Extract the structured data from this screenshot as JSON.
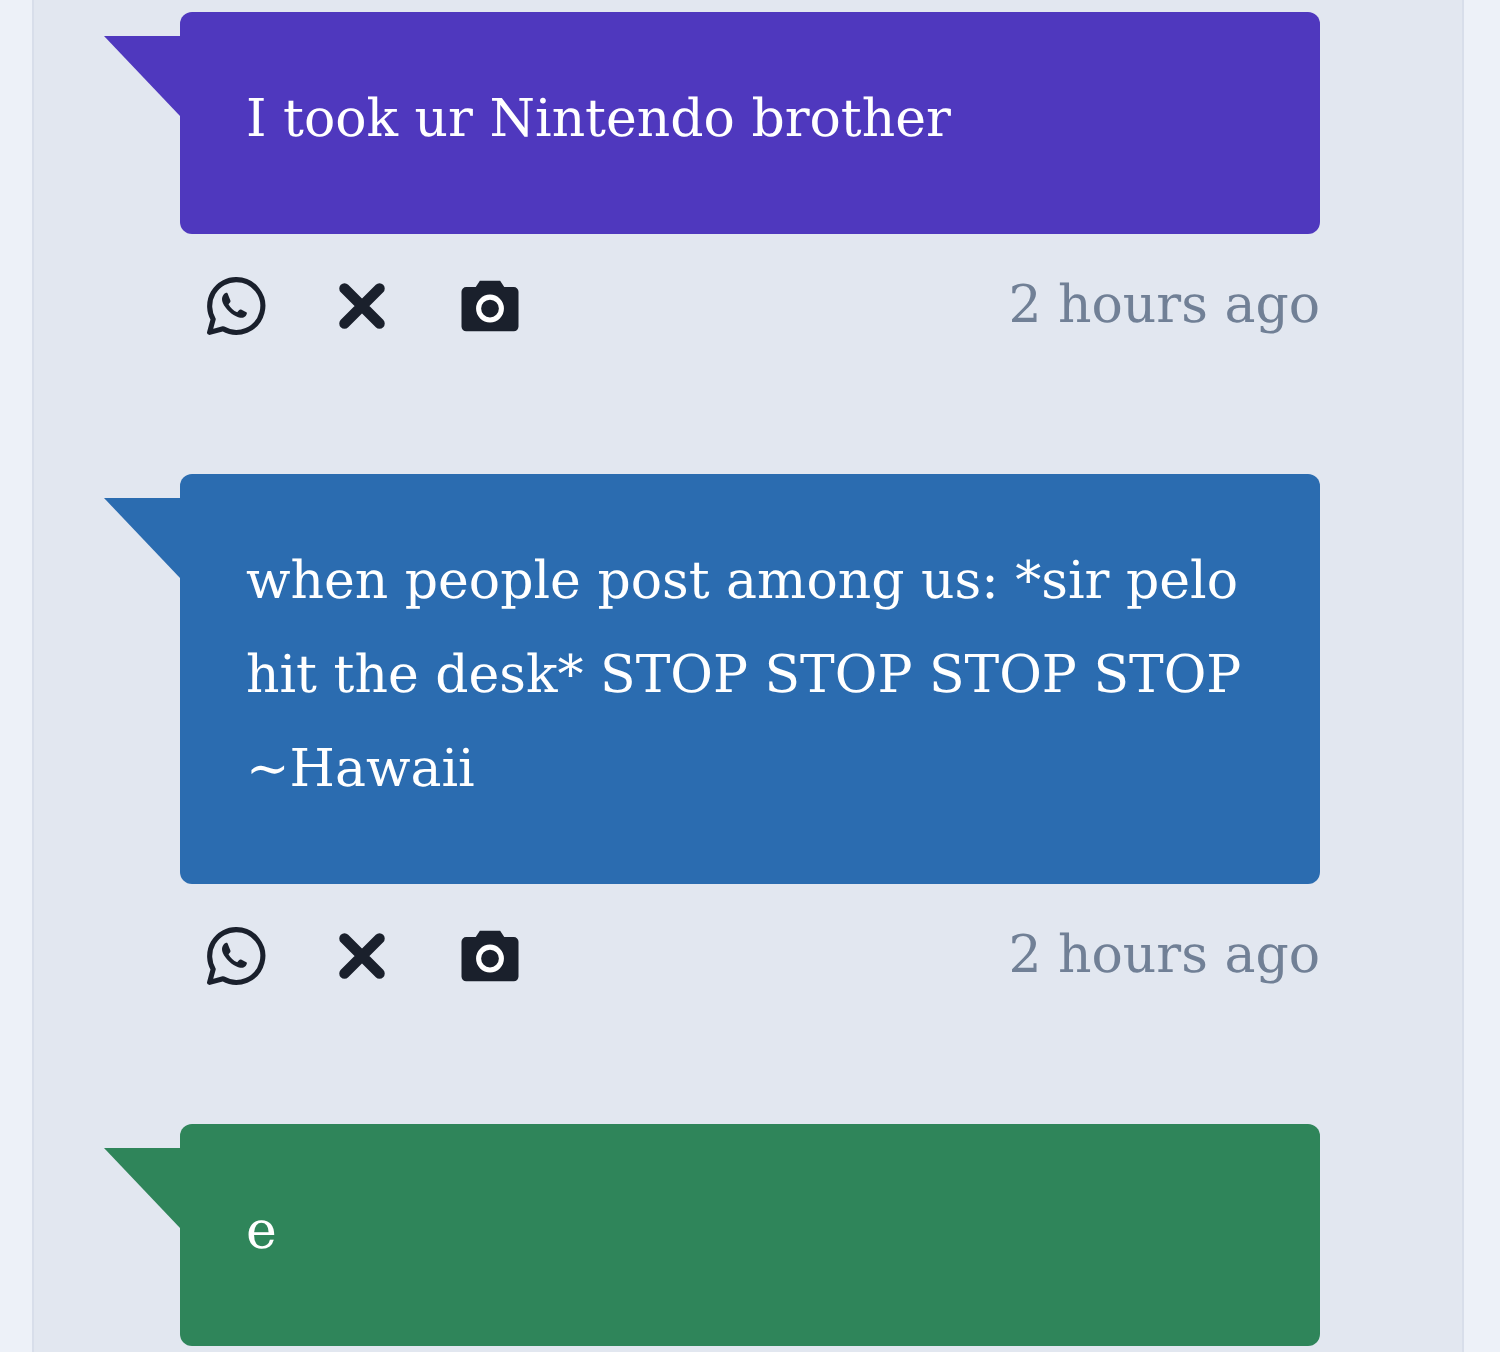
{
  "messages": [
    {
      "text": "I took ur Nintendo brother",
      "color": "#4f38be",
      "time": "2 hours ago"
    },
    {
      "text": "when people post among us: *sir pelo hit the desk* STOP STOP STOP STOP ~Hawaii",
      "color": "#2b6cb0",
      "time": "2 hours ago"
    },
    {
      "text": "e",
      "color": "#2f855a"
    }
  ]
}
